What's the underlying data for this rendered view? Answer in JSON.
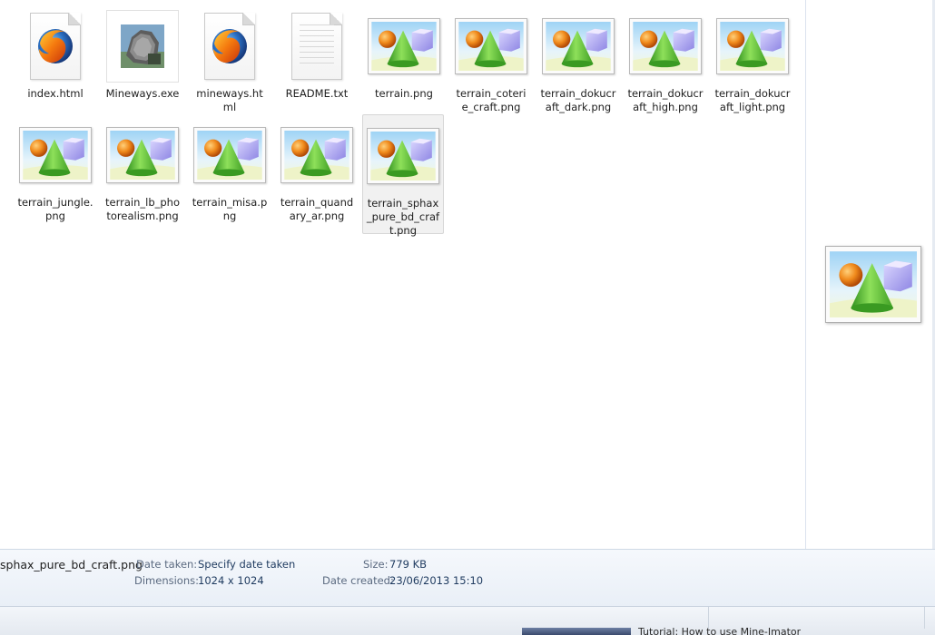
{
  "files": [
    {
      "name": "index.html",
      "type": "firefox-html-icon"
    },
    {
      "name": "Mineways.exe",
      "type": "exe-thumbnail-icon"
    },
    {
      "name": "mineways.html",
      "type": "firefox-html-icon"
    },
    {
      "name": "README.txt",
      "type": "text-document-icon"
    },
    {
      "name": "terrain.png",
      "type": "image-thumbnail-icon"
    },
    {
      "name": "terrain_coterie_craft.png",
      "type": "image-thumbnail-icon"
    },
    {
      "name": "terrain_dokucraft_dark.png",
      "type": "image-thumbnail-icon"
    },
    {
      "name": "terrain_dokucraft_high.png",
      "type": "image-thumbnail-icon"
    },
    {
      "name": "terrain_dokucraft_light.png",
      "type": "image-thumbnail-icon"
    },
    {
      "name": "terrain_jungle.png",
      "type": "image-thumbnail-icon"
    },
    {
      "name": "terrain_lb_photorealism.png",
      "type": "image-thumbnail-icon"
    },
    {
      "name": "terrain_misa.png",
      "type": "image-thumbnail-icon"
    },
    {
      "name": "terrain_quandary_ar.png",
      "type": "image-thumbnail-icon"
    },
    {
      "name": "terrain_sphax_pure_bd_craft.png",
      "type": "image-thumbnail-icon",
      "selected": true
    }
  ],
  "details": {
    "filename": "sphax_pure_bd_craft.png",
    "date_taken_label": "Date taken:",
    "date_taken_value": "Specify date taken",
    "dimensions_label": "Dimensions:",
    "dimensions_value": "1024 x 1024",
    "size_label": "Size:",
    "size_value": "779 KB",
    "date_created_label": "Date created:",
    "date_created_value": "23/06/2013 15:10"
  },
  "taskbar": {
    "peek_text": "Tutorial: How to use Mine-Imator"
  },
  "colors": {
    "selection_bg": "#f1f1f1",
    "details_key": "#5b6a80",
    "details_value": "#1e3a5f"
  }
}
